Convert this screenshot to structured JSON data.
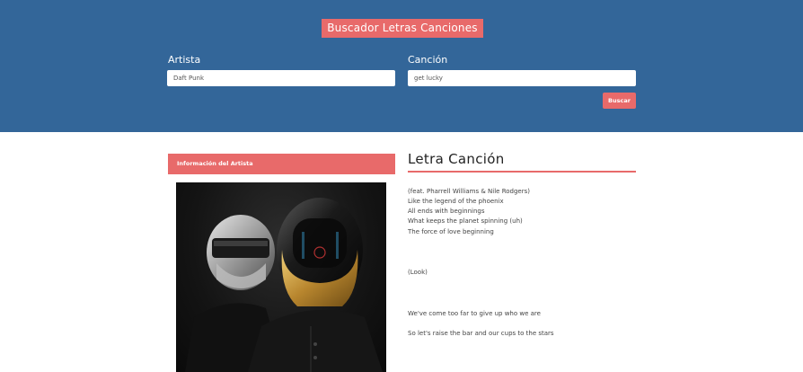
{
  "header": {
    "title": "Buscador Letras Canciones",
    "artist_label": "Artista",
    "artist_value": "Daft Punk",
    "song_label": "Canción",
    "song_value": "get lucky",
    "search_button": "Buscar"
  },
  "artist_panel": {
    "heading": "Información del Artista"
  },
  "lyrics": {
    "heading": "Letra Canción",
    "lines": [
      "(feat. Pharrell Williams & Nile Rodgers)",
      "Like the legend of the phoenix",
      "All ends with beginnings",
      "What keeps the planet spinning (uh)",
      "The force of love beginning",
      "(Look)",
      "We've come too far to give up who we are",
      "So let's raise the bar and our cups to the stars"
    ]
  },
  "colors": {
    "header_bg": "#336699",
    "accent": "#e86a6a"
  }
}
